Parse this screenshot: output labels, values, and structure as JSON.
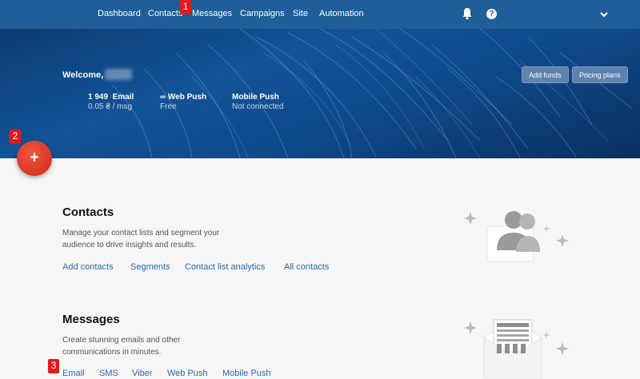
{
  "nav": {
    "items": [
      "Dashboard",
      "Contacts",
      "Messages",
      "Campaigns",
      "Site",
      "Automation"
    ],
    "bell_icon": "bell-icon",
    "help_icon": "help-icon",
    "help_symbol": "?",
    "menu_icon": "chevron-down-icon"
  },
  "markers": [
    "1",
    "2",
    "3"
  ],
  "hero": {
    "welcome": "Welcome,",
    "stats": [
      {
        "value": "1 949",
        "label": "Email",
        "sub": "0.05 ₴ / msg"
      },
      {
        "value": "∞",
        "label": "Web Push",
        "sub": "Free"
      },
      {
        "value": "",
        "label": "Mobile Push",
        "sub": "Not connected"
      }
    ],
    "buttons": [
      "Add funds",
      "Pricing plans"
    ]
  },
  "fab": {
    "symbol": "+"
  },
  "contacts": {
    "title": "Contacts",
    "description": "Manage your contact lists and segment your audience to drive insights and results.",
    "links": [
      "Add contacts",
      "Segments",
      "Contact list analytics",
      "All contacts"
    ]
  },
  "messages": {
    "title": "Messages",
    "description": "Create stunning emails and other communications in minutes.",
    "links": [
      "Email",
      "SMS",
      "Viber",
      "Web Push",
      "Mobile Push"
    ]
  },
  "colors": {
    "nav_bg": "#1f5e98",
    "link": "#2a6ab0",
    "fab": "#d93a26",
    "marker": "#e21a1a"
  }
}
